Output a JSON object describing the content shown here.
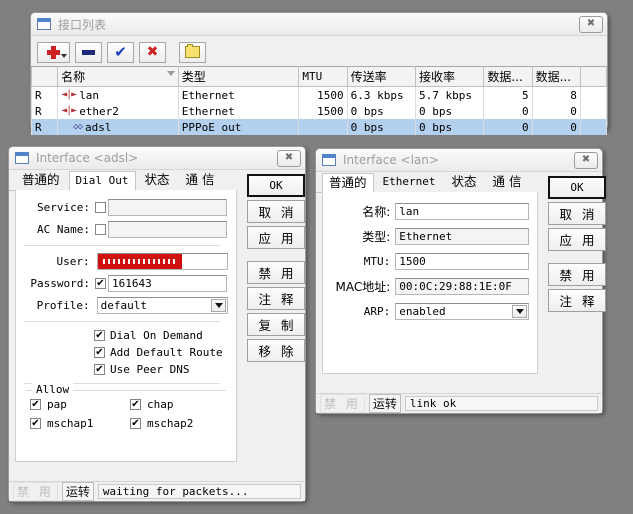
{
  "iflist": {
    "title": "接口列表",
    "close_label": "✖",
    "toolbar": [
      {
        "name": "add-button",
        "icon": "plus-icon",
        "label": "+"
      },
      {
        "name": "remove-button",
        "icon": "minus-icon",
        "label": "−"
      },
      {
        "name": "enable-button",
        "icon": "check-icon",
        "label": "✔"
      },
      {
        "name": "disable-button",
        "icon": "cross-icon",
        "label": "✖"
      },
      {
        "name": "comment-button",
        "icon": "folder-icon",
        "label": ""
      }
    ],
    "columns": [
      "",
      "名称",
      "类型",
      "MTU",
      "传送率",
      "接收率",
      "数据...",
      "数据...",
      ""
    ],
    "rows": [
      {
        "flag": "R",
        "icon": "ethernet-icon",
        "name": "lan",
        "type": "Ethernet",
        "mtu": "1500",
        "tx": "6.3 kbps",
        "rx": "5.7 kbps",
        "txp": "5",
        "rxp": "8",
        "selected": false,
        "indent": false
      },
      {
        "flag": "R",
        "icon": "ethernet-icon",
        "name": "ether2",
        "type": "Ethernet",
        "mtu": "1500",
        "tx": "0 bps",
        "rx": "0 bps",
        "txp": "0",
        "rxp": "0",
        "selected": false,
        "indent": false
      },
      {
        "flag": "R",
        "icon": "pppoe-icon",
        "name": "adsl",
        "type": "PPPoE out",
        "mtu": "",
        "tx": "0 bps",
        "rx": "0 bps",
        "txp": "0",
        "rxp": "0",
        "selected": true,
        "indent": true
      }
    ]
  },
  "adsl": {
    "title": "Interface <adsl>",
    "close_label": "✖",
    "tabs": [
      {
        "label": "普通的",
        "zh": true,
        "active": false
      },
      {
        "label": "Dial Out",
        "zh": false,
        "active": true
      },
      {
        "label": "状态",
        "zh": true,
        "active": false
      },
      {
        "label": "通  信",
        "zh": true,
        "active": false
      }
    ],
    "fields": {
      "service_label": "Service:",
      "service_value": "",
      "service_checked": false,
      "ac_name_label": "AC Name:",
      "ac_name_value": "",
      "ac_name_checked": false,
      "user_label": "User:",
      "user_value": "",
      "user_redacted": true,
      "password_label": "Password:",
      "password_value": "161643",
      "password_checked": true,
      "profile_label": "Profile:",
      "profile_value": "default"
    },
    "options": [
      {
        "label": "Dial On Demand",
        "checked": true
      },
      {
        "label": "Add Default Route",
        "checked": true
      },
      {
        "label": "Use Peer DNS",
        "checked": true
      }
    ],
    "allow": {
      "title": "Allow",
      "items": [
        {
          "label": "pap",
          "checked": true
        },
        {
          "label": "chap",
          "checked": true
        },
        {
          "label": "mschap1",
          "checked": true
        },
        {
          "label": "mschap2",
          "checked": true
        }
      ]
    },
    "buttons": [
      {
        "label": "OK",
        "mono": true,
        "default": true
      },
      {
        "label": "取 消",
        "mono": false,
        "default": false
      },
      {
        "label": "应 用",
        "mono": false,
        "default": false
      },
      {
        "label": "禁 用",
        "mono": false,
        "default": false,
        "gapBefore": true
      },
      {
        "label": "注 释",
        "mono": false,
        "default": false
      },
      {
        "label": "复 制",
        "mono": false,
        "default": false
      },
      {
        "label": "移 除",
        "mono": false,
        "default": false
      }
    ],
    "status": {
      "disabled_label": "禁 用",
      "running_label": "运转",
      "message": "waiting for packets..."
    }
  },
  "lan": {
    "title": "Interface <lan>",
    "close_label": "✖",
    "tabs": [
      {
        "label": "普通的",
        "zh": true,
        "active": true
      },
      {
        "label": "Ethernet",
        "zh": false,
        "active": false
      },
      {
        "label": "状态",
        "zh": true,
        "active": false
      },
      {
        "label": "通  信",
        "zh": true,
        "active": false
      }
    ],
    "fields": {
      "name_label": "名称:",
      "name_value": "lan",
      "type_label": "类型:",
      "type_value": "Ethernet",
      "mtu_label": "MTU:",
      "mtu_value": "1500",
      "mac_label": "MAC地址:",
      "mac_value": "00:0C:29:88:1E:0F",
      "arp_label": "ARP:",
      "arp_value": "enabled"
    },
    "buttons": [
      {
        "label": "OK",
        "mono": true,
        "default": true
      },
      {
        "label": "取 消",
        "mono": false,
        "default": false
      },
      {
        "label": "应 用",
        "mono": false,
        "default": false
      },
      {
        "label": "禁 用",
        "mono": false,
        "default": false,
        "gapBefore": true
      },
      {
        "label": "注 释",
        "mono": false,
        "default": false
      }
    ],
    "status": {
      "disabled_label": "禁 用",
      "running_label": "运转",
      "message": "link ok"
    }
  },
  "colors": {
    "desktop": "#808080",
    "window": "#f0f0f0",
    "selection": "#b3d1ee",
    "redaction": "#d01010",
    "accent": "#4f84c8"
  }
}
